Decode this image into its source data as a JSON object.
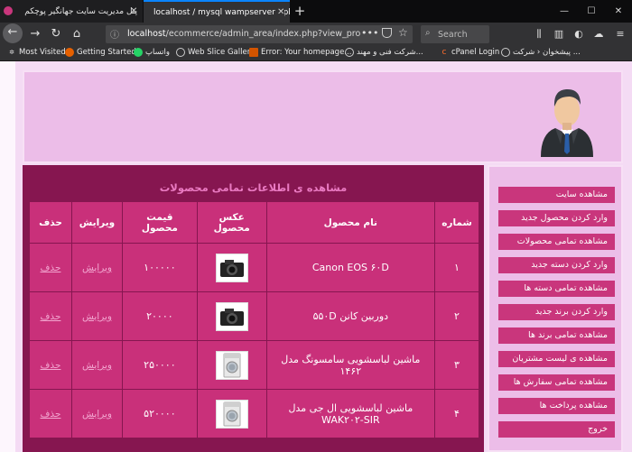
{
  "browser": {
    "tabs": [
      {
        "title": "پنل مدیریت سایت جهانگیر پوچکم"
      },
      {
        "title": "localhost / mysql wampserver | ph"
      }
    ],
    "url_host": "localhost",
    "url_path": "/ecommerce/admin_area/index.php?view_pro",
    "search_placeholder": "Search",
    "bookmarks": [
      {
        "label": "Most Visited"
      },
      {
        "label": "Getting Started"
      },
      {
        "label": "واتساپ"
      },
      {
        "label": "Web Slice Gallery"
      },
      {
        "label": "Error: Your homepage..."
      },
      {
        "label": "شرکت فنی و مهند..."
      },
      {
        "label": "cPanel Login"
      },
      {
        "label": "پیشخوان ‹ شرکت ..."
      }
    ]
  },
  "sidebar": {
    "items": [
      {
        "label": "مشاهده سایت"
      },
      {
        "label": "وارد کردن محصول جدید"
      },
      {
        "label": "مشاهده تمامی محصولات"
      },
      {
        "label": "وارد کردن دسته جدید"
      },
      {
        "label": "مشاهده تمامی دسته ها"
      },
      {
        "label": "وارد کردن برند جدید"
      },
      {
        "label": "مشاهده تمامی برند ها"
      },
      {
        "label": "مشاهده ی لیست مشتریان"
      },
      {
        "label": "مشاهده تمامی سفارش ها"
      },
      {
        "label": "مشاهده پرداخت ها"
      },
      {
        "label": "خروج"
      }
    ]
  },
  "main": {
    "title": "مشاهده ی اطلاعات تمامی محصولات",
    "columns": {
      "number": "شماره",
      "name": "نام محصول",
      "image": "عکس محصول",
      "price": "قیمت محصول",
      "edit": "ویرایش",
      "delete": "حذف"
    },
    "rows": [
      {
        "num": "۱",
        "name": "Canon EOS ۶۰D",
        "image": "camera-dslr",
        "price": "۱۰۰۰۰۰",
        "edit": "ویرایش",
        "delete": "حذف"
      },
      {
        "num": "۲",
        "name": "دوربین کانن ۵۵۰D",
        "image": "camera-dslr",
        "price": "۲۰۰۰۰",
        "edit": "ویرایش",
        "delete": "حذف"
      },
      {
        "num": "۳",
        "name": "ماشین لباسشویی سامسونگ مدل ۱۴۶۲",
        "image": "washing-machine",
        "price": "۲۵۰۰۰۰",
        "edit": "ویرایش",
        "delete": "حذف"
      },
      {
        "num": "۴",
        "name": "ماشین لباسشویی ال جی مدل WAK۲۰۲-SIR",
        "image": "washing-machine",
        "price": "۵۲۰۰۰۰",
        "edit": "ویرایش",
        "delete": "حذف"
      }
    ]
  },
  "colors": {
    "menu_item": "#c9367c",
    "table_cell": "#c9307a",
    "panel_dark": "#861650",
    "header_bg": "#ecbde8"
  }
}
